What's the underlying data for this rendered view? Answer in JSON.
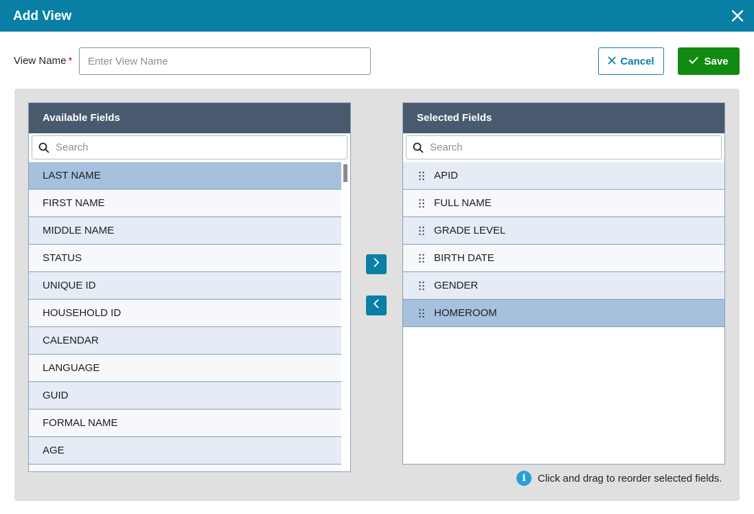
{
  "dialog": {
    "title": "Add View"
  },
  "view_name": {
    "label": "View Name",
    "required_mark": "*",
    "placeholder": "Enter View Name",
    "value": ""
  },
  "actions": {
    "cancel_label": "Cancel",
    "save_label": "Save"
  },
  "available": {
    "header": "Available Fields",
    "search_placeholder": "Search",
    "items": [
      {
        "label": "LAST NAME"
      },
      {
        "label": "FIRST NAME"
      },
      {
        "label": "MIDDLE NAME"
      },
      {
        "label": "STATUS"
      },
      {
        "label": "UNIQUE ID"
      },
      {
        "label": "HOUSEHOLD ID"
      },
      {
        "label": "CALENDAR"
      },
      {
        "label": "LANGUAGE"
      },
      {
        "label": "GUID"
      },
      {
        "label": "FORMAL NAME"
      },
      {
        "label": "AGE"
      },
      {
        "label": ""
      }
    ]
  },
  "selected": {
    "header": "Selected Fields",
    "search_placeholder": "Search",
    "items": [
      {
        "label": "APID"
      },
      {
        "label": "FULL NAME"
      },
      {
        "label": "GRADE LEVEL"
      },
      {
        "label": "BIRTH DATE"
      },
      {
        "label": "GENDER"
      },
      {
        "label": "HOMEROOM"
      }
    ]
  },
  "hint": {
    "text": "Click and drag to reorder selected fields.",
    "icon": "info-icon"
  },
  "colors": {
    "titlebar": "#0a7fa6",
    "save": "#128a12",
    "panel_header": "#4a5a6e",
    "row_alt": "#e5ecf6",
    "row_selected": "#a6c1de"
  }
}
